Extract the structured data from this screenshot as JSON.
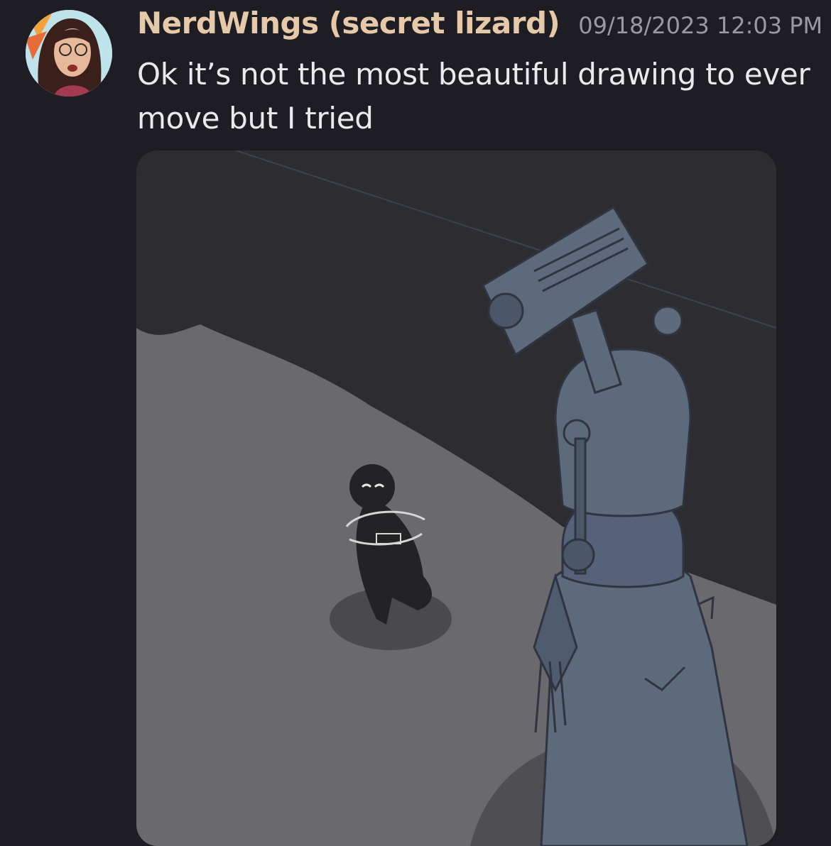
{
  "message": {
    "author": "NerdWings (secret lizard)",
    "timestamp": "09/18/2023 12:03 PM",
    "text_line1": "Ok it’s not the most beautiful drawing to ever",
    "text_line2": "move but I tried"
  },
  "avatar": {
    "icon": "user-avatar-icon"
  },
  "attachment": {
    "type": "drawing-image",
    "icon": "image-attachment"
  }
}
